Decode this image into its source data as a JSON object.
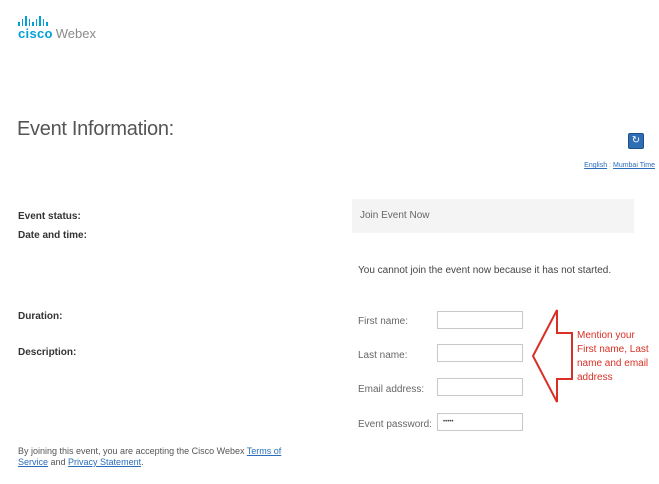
{
  "brand": {
    "cisco": "cisco",
    "webex": "Webex",
    "accent": "#049fd9"
  },
  "page_title": "Event Information:",
  "header_links": {
    "language": "English",
    "separator": ":",
    "timezone": "Mumbai Time"
  },
  "event_info": {
    "status_label": "Event status:",
    "datetime_label": "Date and time:",
    "duration_label": "Duration:",
    "description_label": "Description:"
  },
  "join": {
    "title": "Join Event Now",
    "notice": "You cannot join the event now because it has not started.",
    "fields": {
      "first_name": {
        "label": "First name:",
        "value": ""
      },
      "last_name": {
        "label": "Last name:",
        "value": ""
      },
      "email": {
        "label": "Email address:",
        "value": ""
      },
      "password": {
        "label": "Event password:",
        "value": "•••••"
      }
    }
  },
  "callout": {
    "text": "Mention your First name, Last name and email address",
    "color": "#d93025"
  },
  "footer": {
    "prefix": "By joining this event, you are accepting the Cisco Webex ",
    "terms_link": "Terms of Service",
    "and": " and ",
    "privacy_link": "Privacy Statement",
    "suffix": "."
  },
  "icons": {
    "refresh": "refresh-icon"
  }
}
